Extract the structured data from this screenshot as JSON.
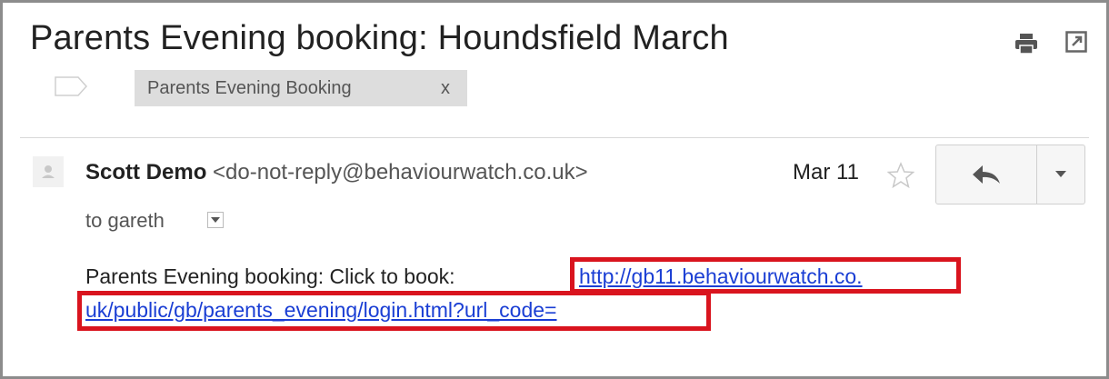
{
  "email": {
    "subject": "Parents Evening booking: Houndsfield March",
    "label": {
      "text": "Parents Evening Booking",
      "remove": "x"
    },
    "sender": {
      "name": "Scott Demo",
      "address": "<do-not-reply@behaviourwatch.co.uk>"
    },
    "date": "Mar 11",
    "recipient": "to gareth",
    "body_prefix": "Parents Evening booking: Click to book: ",
    "link_line1": "http://gb11.behaviourwatch.co.",
    "link_line2": "uk/public/gb/parents_evening/login.html?url_code="
  },
  "icons": {
    "print": "print-icon",
    "new_window": "open-in-new-window-icon",
    "label": "label-tag-icon",
    "avatar": "person-avatar-icon",
    "star": "star-icon",
    "reply": "reply-arrow-icon",
    "more": "dropdown-triangle-icon",
    "details": "show-details-icon"
  },
  "colors": {
    "link": "#1a3ed4",
    "highlight": "#d9141e",
    "label_chip": "#dddddd"
  }
}
